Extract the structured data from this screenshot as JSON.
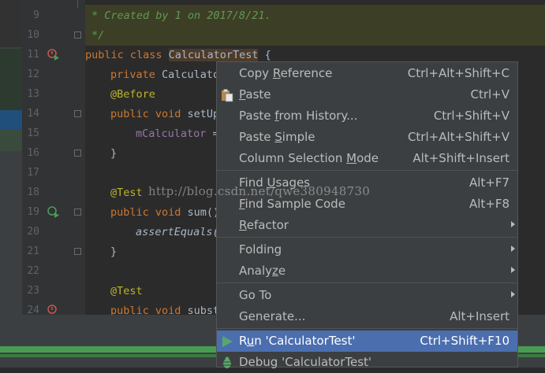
{
  "editor": {
    "line_numbers": [
      "9",
      "10",
      "11",
      "12",
      "13",
      "14",
      "15",
      "16",
      "17",
      "18",
      "19",
      "20",
      "21",
      "22",
      "23",
      "24"
    ],
    "comment_text": "* Created by 1 on 2017/8/21.",
    "comment_end": "*/",
    "code": {
      "l11_kw": "public class ",
      "l11_name": "CalculatorTest",
      "l11_rest": " {",
      "l12_kw": "private ",
      "l12_rest": "Calculato",
      "l13_ann": "@Before",
      "l14_kw": "public void ",
      "l14_rest": "setUp",
      "l15_fld": "mCalculator",
      "l15_rest": " =",
      "l16": "}",
      "l18_ann": "@Test",
      "l19_kw": "public void ",
      "l19_rest": "sum()",
      "l20_it": "assertEquals(",
      "l21": "}",
      "l23_ann": "@Test",
      "l24_kw": "public void ",
      "l24_rest": "subst"
    },
    "watermark": "http://blog.csdn.net/qwe380948730"
  },
  "menu": {
    "items": [
      {
        "label_pre": "Copy ",
        "label_u": "R",
        "label_post": "eference",
        "shortcut": "Ctrl+Alt+Shift+C"
      },
      {
        "label_pre": "",
        "label_u": "P",
        "label_post": "aste",
        "shortcut": "Ctrl+V"
      },
      {
        "label_pre": "Paste ",
        "label_u": "f",
        "label_post": "rom History...",
        "shortcut": "Ctrl+Shift+V"
      },
      {
        "label_pre": "Paste ",
        "label_u": "S",
        "label_post": "imple",
        "shortcut": "Ctrl+Alt+Shift+V"
      },
      {
        "label_pre": "Column Selection ",
        "label_u": "M",
        "label_post": "ode",
        "shortcut": "Alt+Shift+Insert"
      },
      {
        "label_pre": "Find ",
        "label_u": "U",
        "label_post": "sages",
        "shortcut": "Alt+F7"
      },
      {
        "label_pre": "",
        "label_u": "F",
        "label_post": "ind Sample Code",
        "shortcut": "Alt+F8"
      },
      {
        "label_pre": "",
        "label_u": "R",
        "label_post": "efactor",
        "shortcut": ""
      },
      {
        "label_pre": "Folding",
        "label_u": "",
        "label_post": "",
        "shortcut": ""
      },
      {
        "label_pre": "Analy",
        "label_u": "z",
        "label_post": "e",
        "shortcut": ""
      },
      {
        "label_pre": "Go To",
        "label_u": "",
        "label_post": "",
        "shortcut": ""
      },
      {
        "label_pre": "Generate...",
        "label_u": "",
        "label_post": "",
        "shortcut": "Alt+Insert"
      },
      {
        "label_pre": "R",
        "label_u": "u",
        "label_post": "n 'CalculatorTest'",
        "shortcut": "Ctrl+Shift+F10"
      },
      {
        "label_pre": "Debug 'CalculatorTest'",
        "label_u": "",
        "label_post": "",
        "shortcut": ""
      }
    ],
    "selected_color": "#4b6eaf"
  }
}
